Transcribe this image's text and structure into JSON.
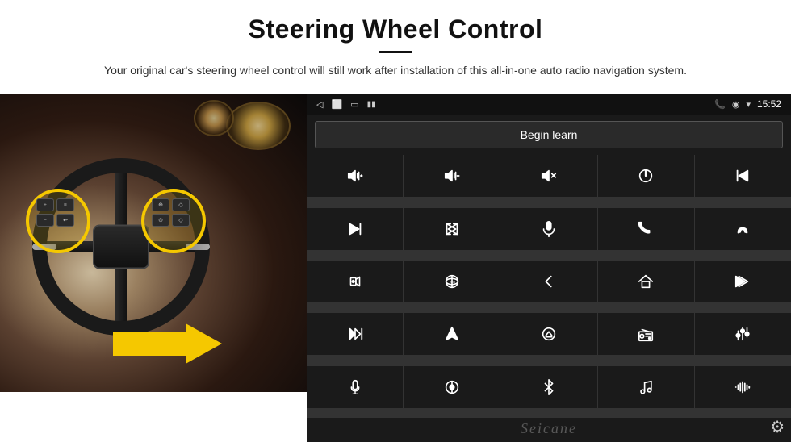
{
  "header": {
    "title": "Steering Wheel Control",
    "subtitle": "Your original car's steering wheel control will still work after installation of this all-in-one auto radio navigation system."
  },
  "status_bar": {
    "time": "15:52",
    "back_icon": "◁",
    "home_icon": "⬜",
    "recent_icon": "▭",
    "phone_icon": "📞",
    "location_icon": "◉",
    "wifi_icon": "▾"
  },
  "begin_learn": {
    "label": "Begin learn"
  },
  "icon_rows": [
    [
      "vol+",
      "vol-",
      "mute",
      "power",
      "prev-track"
    ],
    [
      "next",
      "shuffle",
      "mic",
      "phone",
      "hangup"
    ],
    [
      "speaker",
      "360",
      "back",
      "home",
      "skip-back"
    ],
    [
      "fast-forward",
      "nav",
      "eject",
      "radio",
      "settings-sliders"
    ],
    [
      "mic2",
      "360-2",
      "bluetooth",
      "music",
      "waveform"
    ]
  ],
  "watermark": "Seicane",
  "gear_label": "⚙"
}
